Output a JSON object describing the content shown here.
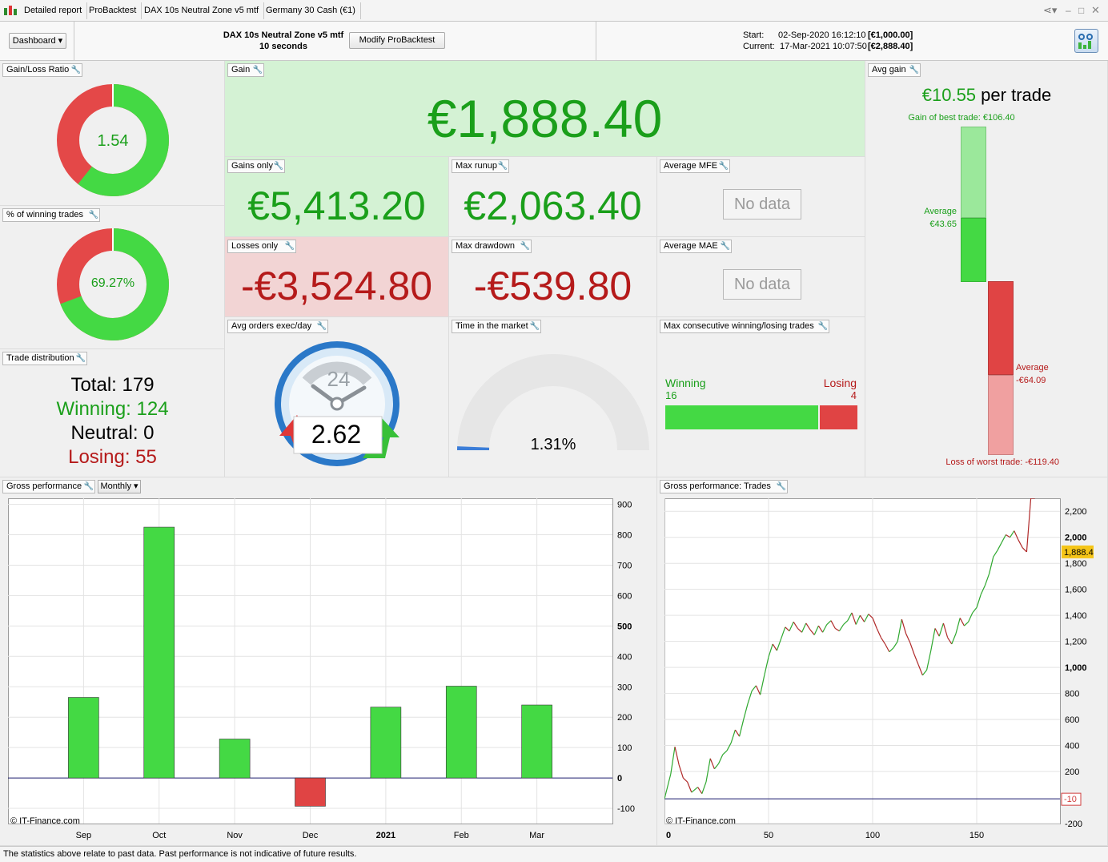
{
  "tabs": [
    "Detailed report",
    "ProBacktest",
    "DAX 10s Neutral Zone v5 mtf",
    "Germany 30 Cash (€1)"
  ],
  "header": {
    "dashboard_label": "Dashboard",
    "strategy_name": "DAX 10s Neutral Zone v5 mtf",
    "timeframe": "10 seconds",
    "modify_button": "Modify ProBacktest",
    "start_label": "Start:",
    "start_date": "02-Sep-2020 16:12:10",
    "start_capital": "[€1,000.00]",
    "current_label": "Current:",
    "current_date": "17-Mar-2021 10:07:50",
    "current_capital": "[€2,888.40]"
  },
  "panels": {
    "gain_loss_ratio": {
      "title": "Gain/Loss Ratio",
      "value": "1.54",
      "fraction": 0.6065
    },
    "pct_winning": {
      "title": "% of winning trades",
      "value": "69.27%",
      "fraction": 0.6927
    },
    "trade_distribution": {
      "title": "Trade distribution",
      "total_label": "Total:",
      "total": "179",
      "winning_label": "Winning:",
      "winning": "124",
      "neutral_label": "Neutral:",
      "neutral": "0",
      "losing_label": "Losing:",
      "losing": "55"
    },
    "gain": {
      "title": "Gain",
      "value": "€1,888.40"
    },
    "gains_only": {
      "title": "Gains only",
      "value": "€5,413.20"
    },
    "losses_only": {
      "title": "Losses only",
      "value": "-€3,524.80"
    },
    "max_runup": {
      "title": "Max runup",
      "value": "€2,063.40"
    },
    "max_drawdown": {
      "title": "Max drawdown",
      "value": "-€539.80"
    },
    "average_mfe": {
      "title": "Average MFE",
      "value": "No data"
    },
    "average_mae": {
      "title": "Average MAE",
      "value": "No data"
    },
    "avg_orders": {
      "title": "Avg orders exec/day",
      "value": "2.62",
      "dial": "24"
    },
    "time_in_market": {
      "title": "Time in the market",
      "value": "1.31%",
      "fraction": 0.0131
    },
    "max_consecutive": {
      "title": "Max consecutive winning/losing trades",
      "winning_label": "Winning",
      "winning": "16",
      "losing_label": "Losing",
      "losing": "4"
    },
    "avg_gain": {
      "title": "Avg gain",
      "per_trade_value": "€10.55",
      "per_trade_label": "per trade",
      "best_trade": "Gain of best trade: €106.40",
      "avg_gain_label": "Average",
      "avg_gain_value": "€43.65",
      "avg_loss_label": "Average",
      "avg_loss_value": "-€64.09",
      "worst_trade": "Loss of worst trade: -€119.40"
    }
  },
  "gross_performance": {
    "title": "Gross performance",
    "period_label": "Monthly",
    "copyright": "© IT-Finance.com"
  },
  "gross_trades": {
    "title": "Gross performance: Trades",
    "copyright": "© IT-Finance.com",
    "last_value_badge": "1,888.4",
    "low_badge": "-10"
  },
  "footer": "The statistics above relate to past data. Past performance is not indicative of future results.",
  "colors": {
    "green": "#44d944",
    "red": "#e04444",
    "text_green": "#1a9f1a",
    "text_red": "#b51a1a"
  },
  "chart_data": [
    {
      "type": "bar",
      "categories": [
        "Sep",
        "Oct",
        "Nov",
        "Dec",
        "2021",
        "Feb",
        "Mar"
      ],
      "values": [
        265,
        825,
        128,
        -93,
        233,
        302,
        240
      ],
      "ylim": [
        -150,
        920
      ],
      "yticks": [
        900,
        800,
        700,
        600,
        500,
        400,
        300,
        200,
        100,
        0,
        -100
      ],
      "grid": true
    },
    {
      "type": "line",
      "xlim": [
        0,
        190
      ],
      "ylim": [
        -200,
        2300
      ],
      "xticks": [
        0,
        50,
        100,
        150
      ],
      "yticks": [
        2200,
        2000,
        1800,
        1600,
        1400,
        1200,
        1000,
        800,
        600,
        400,
        200,
        -200
      ],
      "grid": true,
      "x": [
        0,
        3,
        5,
        7,
        9,
        11,
        13,
        16,
        18,
        20,
        22,
        24,
        26,
        28,
        30,
        32,
        34,
        36,
        38,
        40,
        42,
        44,
        46,
        48,
        50,
        52,
        54,
        56,
        58,
        60,
        62,
        64,
        66,
        68,
        70,
        72,
        74,
        76,
        78,
        80,
        82,
        84,
        86,
        88,
        90,
        92,
        94,
        96,
        98,
        100,
        102,
        104,
        106,
        108,
        110,
        112,
        114,
        116,
        118,
        120,
        122,
        124,
        126,
        128,
        130,
        132,
        134,
        136,
        138,
        140,
        142,
        144,
        146,
        148,
        150,
        152,
        154,
        156,
        158,
        160,
        162,
        164,
        166,
        168,
        170,
        172,
        174,
        176,
        178
      ],
      "y": [
        -10,
        180,
        390,
        250,
        150,
        120,
        40,
        80,
        30,
        120,
        300,
        220,
        260,
        330,
        360,
        420,
        520,
        470,
        600,
        720,
        820,
        860,
        790,
        940,
        1080,
        1180,
        1130,
        1220,
        1310,
        1280,
        1350,
        1300,
        1270,
        1340,
        1290,
        1250,
        1320,
        1270,
        1330,
        1360,
        1300,
        1280,
        1330,
        1360,
        1420,
        1330,
        1400,
        1350,
        1410,
        1380,
        1300,
        1230,
        1180,
        1120,
        1150,
        1200,
        1370,
        1260,
        1190,
        1100,
        1020,
        940,
        980,
        1130,
        1300,
        1240,
        1340,
        1230,
        1180,
        1260,
        1380,
        1320,
        1350,
        1420,
        1460,
        1560,
        1630,
        1720,
        1850,
        1900,
        1960,
        2020,
        2000,
        2050,
        1980,
        1920,
        1888
      ]
    }
  ]
}
